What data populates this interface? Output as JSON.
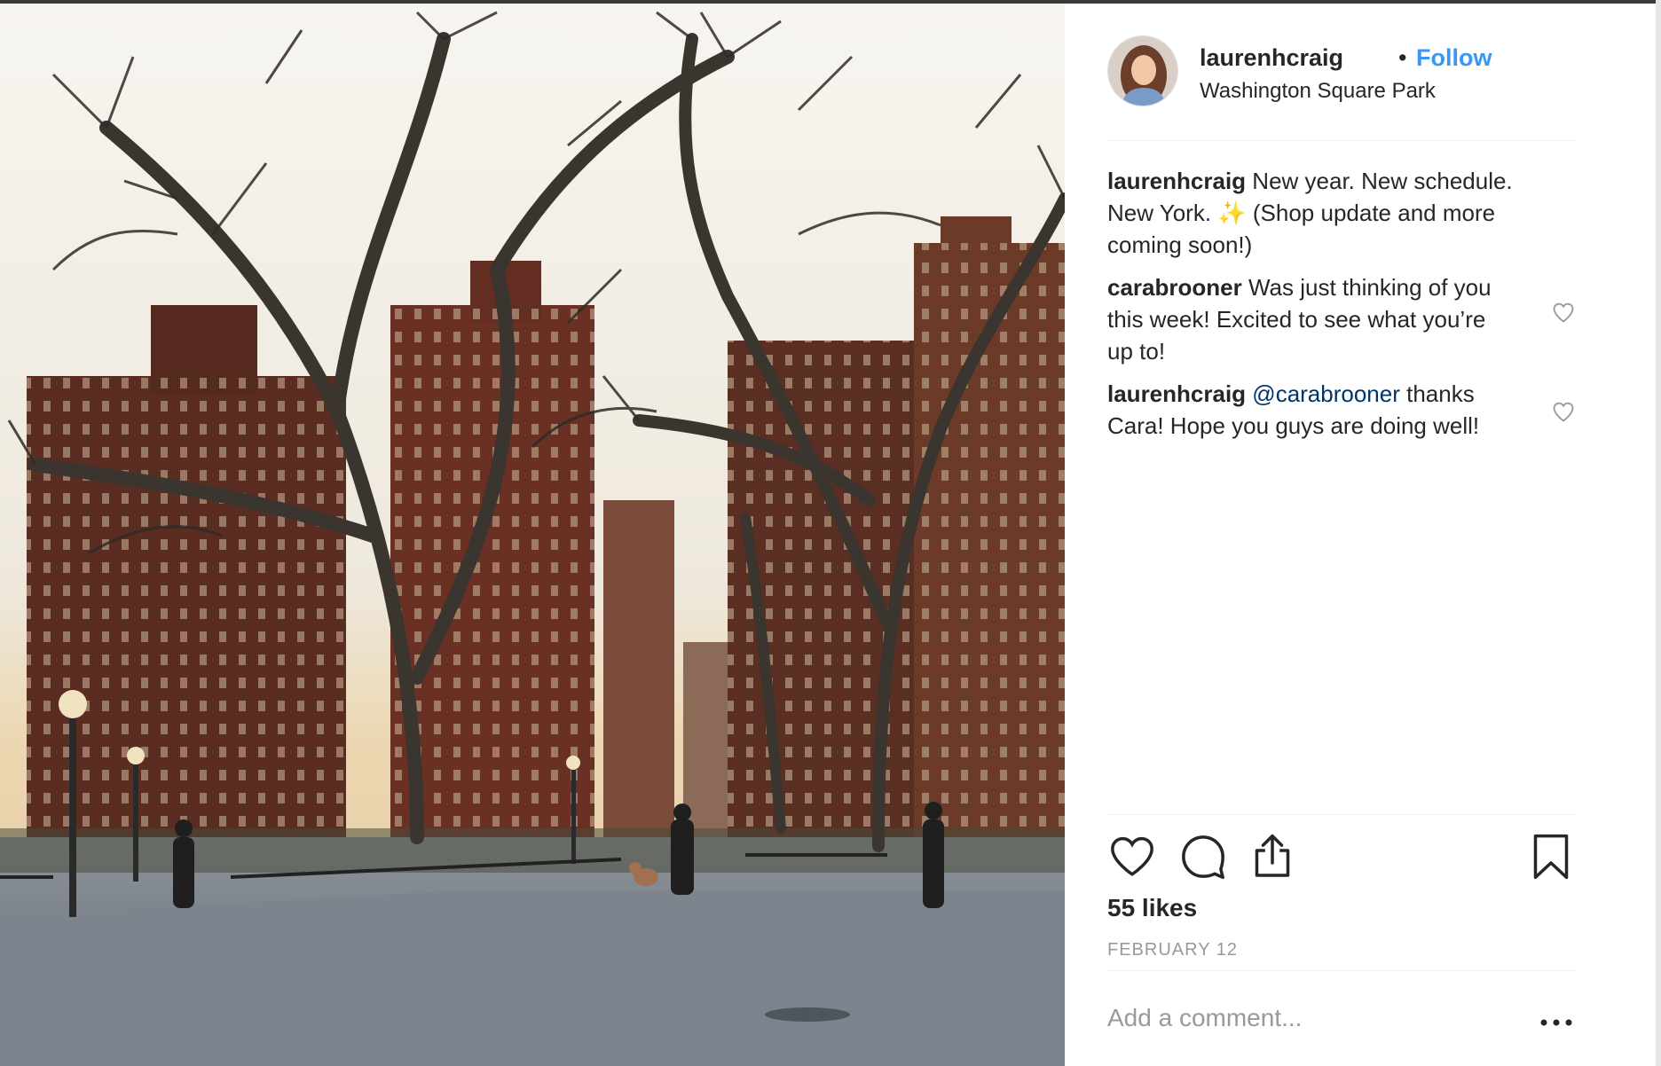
{
  "post": {
    "photo_alt": "Washington Square Park at dusk with bare trees, brick buildings and a person walking a dog",
    "header": {
      "username": "laurenhcraig",
      "separator": "•",
      "follow_label": "Follow",
      "location": "Washington Square Park"
    },
    "comments": [
      {
        "username": "laurenhcraig",
        "text": "New year. New schedule. New York. ✨  (Shop update and more coming soon!)"
      },
      {
        "username": "carabrooner",
        "text": "Was just thinking of you this week! Excited to see what you’re up to!"
      },
      {
        "username": "laurenhcraig",
        "mention": "@carabrooner",
        "text": "thanks Cara! Hope you guys are doing well!"
      }
    ],
    "likes_text": "55 likes",
    "date": "FEBRUARY 12",
    "add_comment_placeholder": "Add a comment...",
    "icons": {
      "like": "heart-icon",
      "comment": "comment-bubble-icon",
      "share": "share-icon",
      "save": "bookmark-icon",
      "more": "more-options-icon"
    },
    "colors": {
      "link_blue": "#3897f0",
      "mention_blue": "#003569",
      "text": "#262626",
      "muted": "#999999",
      "divider": "#efefef"
    }
  }
}
